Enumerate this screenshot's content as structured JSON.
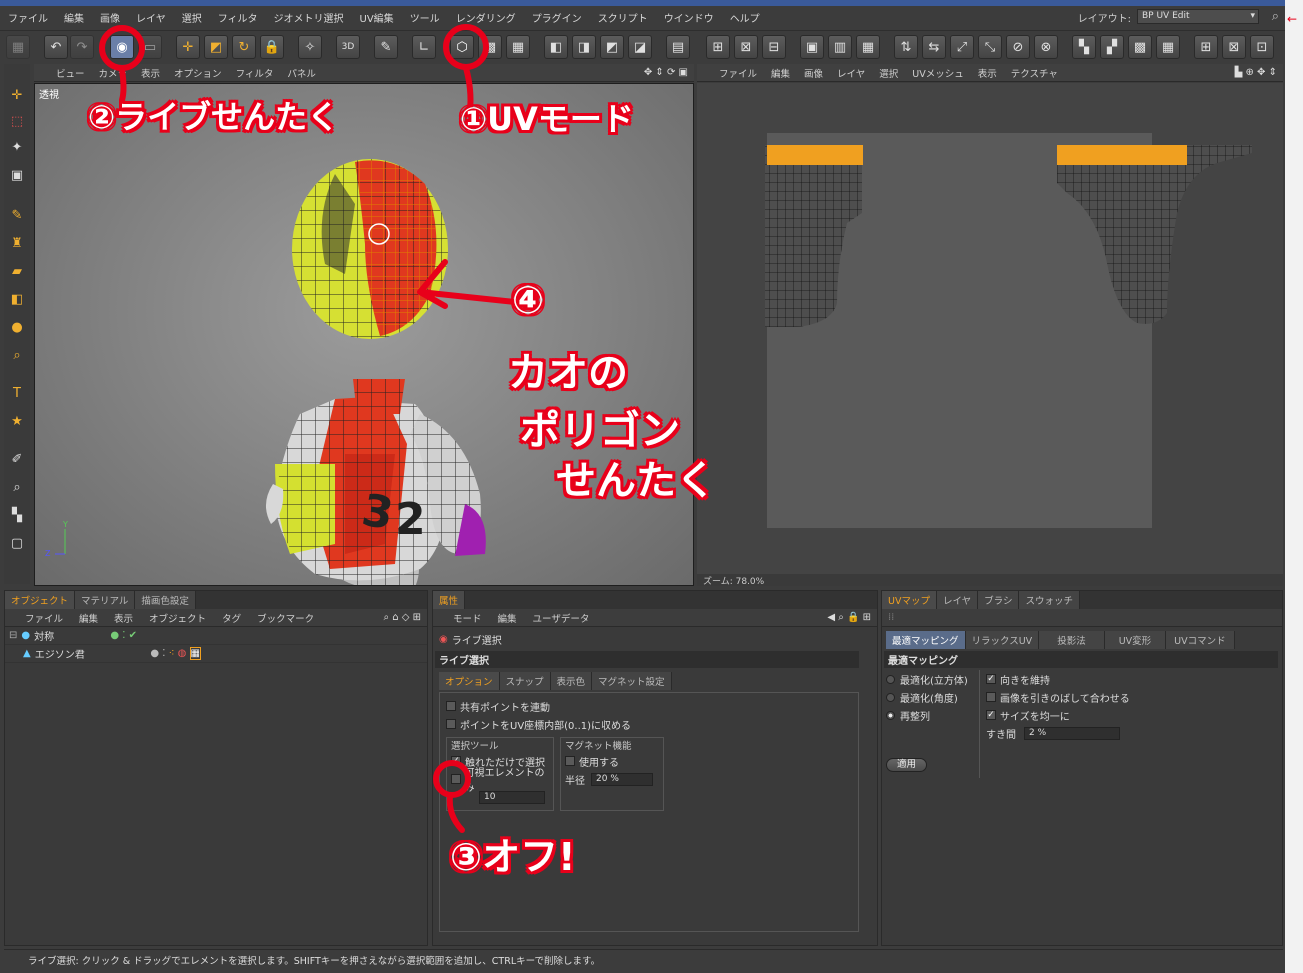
{
  "menubar": {
    "items": [
      "ファイル",
      "編集",
      "画像",
      "レイヤ",
      "選択",
      "フィルタ",
      "ジオメトリ選択",
      "UV編集",
      "ツール",
      "レンダリング",
      "プラグイン",
      "スクリプト",
      "ウインドウ",
      "ヘルプ"
    ],
    "layout_label": "レイアウト:",
    "layout_value": "BP UV Edit"
  },
  "viewport": {
    "menu": [
      "ビュー",
      "カメラ",
      "表示",
      "オプション",
      "フィルタ",
      "パネル"
    ],
    "label": "透視"
  },
  "uv_view": {
    "menu": [
      "ファイル",
      "編集",
      "画像",
      "レイヤ",
      "選択",
      "UVメッシュ",
      "表示",
      "テクスチャ"
    ],
    "zoom": "ズーム: 78.0%"
  },
  "objects_panel": {
    "tabs": [
      "オブジェクト",
      "マテリアル",
      "描画色設定"
    ],
    "menu": [
      "ファイル",
      "編集",
      "表示",
      "オブジェクト",
      "タグ",
      "ブックマーク"
    ],
    "rows": [
      "対称",
      "エジソン君"
    ]
  },
  "attributes_panel": {
    "tab": "属性",
    "menu": [
      "モード",
      "編集",
      "ユーザデータ"
    ],
    "tool_name": "ライブ選択",
    "section": "ライブ選択",
    "subtabs": [
      "オプション",
      "スナップ",
      "表示色",
      "マグネット設定"
    ],
    "opt1": "共有ポイントを連動",
    "opt2": "ポイントをUV座標内部(0..1)に収める",
    "group_select": "選択ツール",
    "touch_select": "触れただけで選択",
    "visible_only": "可視エレメントのみ",
    "radius_val": "10",
    "group_magnet": "マグネット機能",
    "magnet_use": "使用する",
    "magnet_radius_label": "半径",
    "magnet_radius_val": "20 %"
  },
  "uvmap_panel": {
    "tabs": [
      "UVマップ",
      "レイヤ",
      "ブラシ",
      "スウォッチ"
    ],
    "subtabs": [
      "最適マッピング",
      "リラックスUV",
      "投影法",
      "UV変形",
      "UVコマンド"
    ],
    "section": "最適マッピング",
    "radios": [
      "最適化(立方体)",
      "最適化(角度)",
      "再整列"
    ],
    "checks": [
      "向きを維持",
      "画像を引きのばして合わせる",
      "サイズを均一に"
    ],
    "gap_label": "すき間",
    "gap_val": "2 %",
    "apply": "適用"
  },
  "statusbar": "ライブ選択: クリック & ドラッグでエレメントを選択します。SHIFTキーを押さえながら選択範囲を追加し、CTRLキーで削除します。",
  "annotations": {
    "a1": "①UVモード",
    "a2": "②ライブせんたく",
    "a3": "③オフ!",
    "a4": "④",
    "a4_text1": "カオの",
    "a4_text2": "ポリゴン",
    "a4_text3": "せんたく"
  },
  "colors": {
    "accent": "#f0a020",
    "annotation": "#e8001a"
  }
}
